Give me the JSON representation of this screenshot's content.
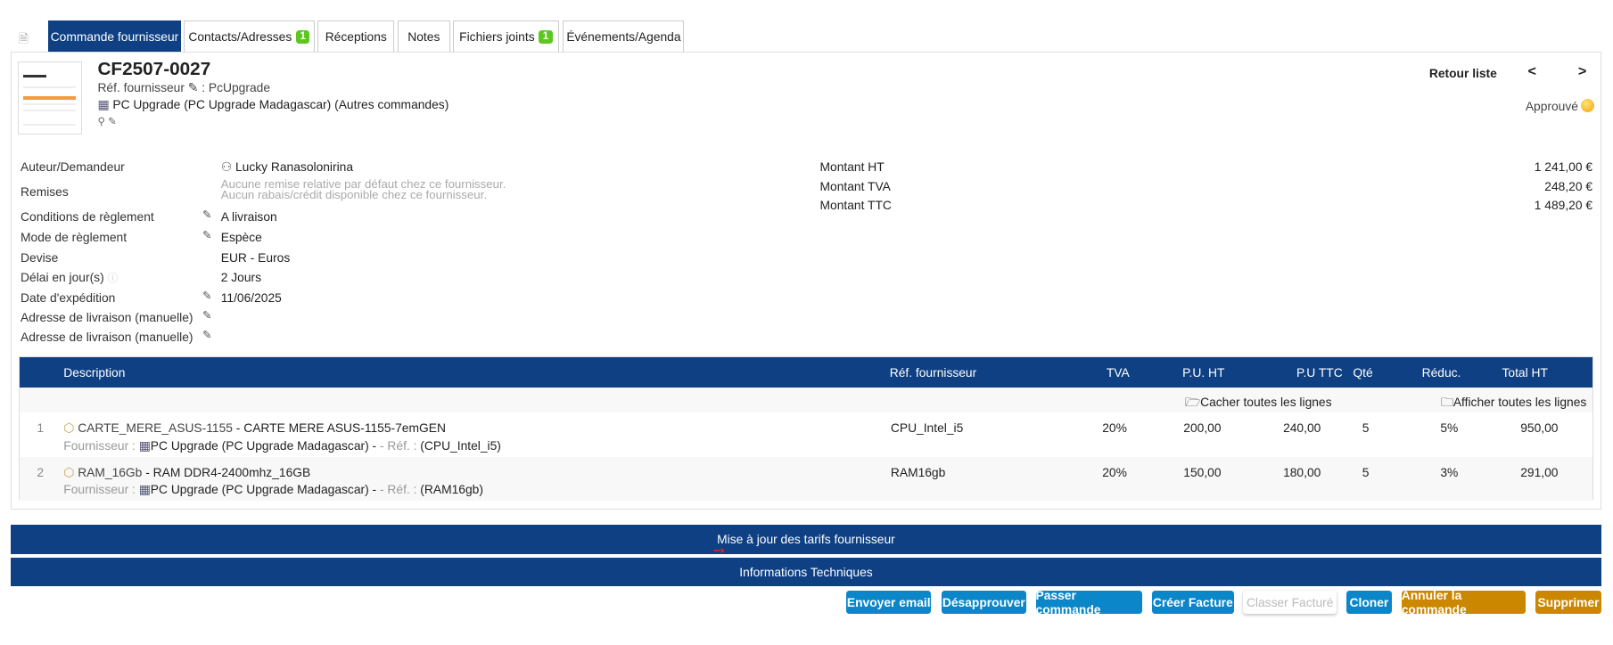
{
  "tabs": [
    {
      "label": "Commande fournisseur",
      "active": true
    },
    {
      "label": "Contacts/Adresses",
      "badge": "1"
    },
    {
      "label": "Réceptions"
    },
    {
      "label": "Notes"
    },
    {
      "label": "Fichiers joints",
      "badge": "1"
    },
    {
      "label": "Événements/Agenda"
    }
  ],
  "header": {
    "ref": "CF2507-0027",
    "supplier_ref_label": "Réf. fournisseur",
    "supplier_ref_value": ": PcUpgrade",
    "supplier": "PC Upgrade (PC Upgrade Madagascar)",
    "other_orders": "(Autres commandes)",
    "back_to_list": "Retour liste",
    "prev": "<",
    "next": ">",
    "status": "Approuvé",
    "status_color": "#f5a300"
  },
  "fields": [
    {
      "label": "Auteur/Demandeur",
      "value": "Lucky Ranasolonirina"
    },
    {
      "label": "Remises",
      "value": "Aucune remise relative par défaut chez ce fournisseur.",
      "value2": "Aucun rabais/crédit disponible chez ce fournisseur."
    },
    {
      "label": "Conditions de règlement",
      "value": "A livraison"
    },
    {
      "label": "Mode de règlement",
      "value": "Espèce"
    },
    {
      "label": "Devise",
      "value": "EUR - Euros"
    },
    {
      "label": "Délai en jour(s)",
      "value": "2 Jours"
    },
    {
      "label": "Date d'expédition",
      "value": "11/06/2025"
    },
    {
      "label": "Adresse de livraison (manuelle)",
      "value": ""
    },
    {
      "label": "Adresse de livraison (manuelle)",
      "value": ""
    }
  ],
  "totals": [
    {
      "label": "Montant HT",
      "value": "1 241,00 €"
    },
    {
      "label": "Montant TVA",
      "value": "248,20 €"
    },
    {
      "label": "Montant TTC",
      "value": "1 489,20 €"
    }
  ],
  "table": {
    "columns": [
      "Description",
      "Réf. fournisseur",
      "TVA",
      "P.U. HT",
      "P.U TTC",
      "Qté",
      "Réduc.",
      "Total HT"
    ],
    "hide_all": "Cacher toutes les lignes",
    "show_all": "Afficher toutes les lignes",
    "rows": [
      {
        "num": "1",
        "code": "CARTE_MERE_ASUS-1155",
        "name": "- CARTE MERE ASUS-1155-7emGEN",
        "supplier_label": "Fournisseur :",
        "supplier": "PC Upgrade (PC Upgrade Madagascar)",
        "ref_label": "- Réf. :",
        "ref_paren": "(CPU_Intel_i5)",
        "ref": "CPU_Intel_i5",
        "tva": "20%",
        "pu_ht": "200,00",
        "pu_ttc": "240,00",
        "qty": "5",
        "reduc": "5%",
        "total": "950,00"
      },
      {
        "num": "2",
        "code": "RAM_16Gb",
        "name": "- RAM DDR4-2400mhz_16GB",
        "supplier_label": "Fournisseur :",
        "supplier": "PC Upgrade (PC Upgrade Madagascar)",
        "ref_label": "- Réf. :",
        "ref_paren": "(RAM16gb)",
        "ref": "RAM16gb",
        "tva": "20%",
        "pu_ht": "150,00",
        "pu_ttc": "180,00",
        "qty": "5",
        "reduc": "3%",
        "total": "291,00"
      }
    ]
  },
  "sections": [
    "Mise à jour des tarifs fournisseur",
    "Informations Techniques"
  ],
  "actions": [
    "Envoyer email",
    "Désapprouver",
    "Passer commande",
    "Créer Facture",
    "Classer Facturé",
    "Cloner",
    "Annuler la commande",
    "Supprimer"
  ]
}
